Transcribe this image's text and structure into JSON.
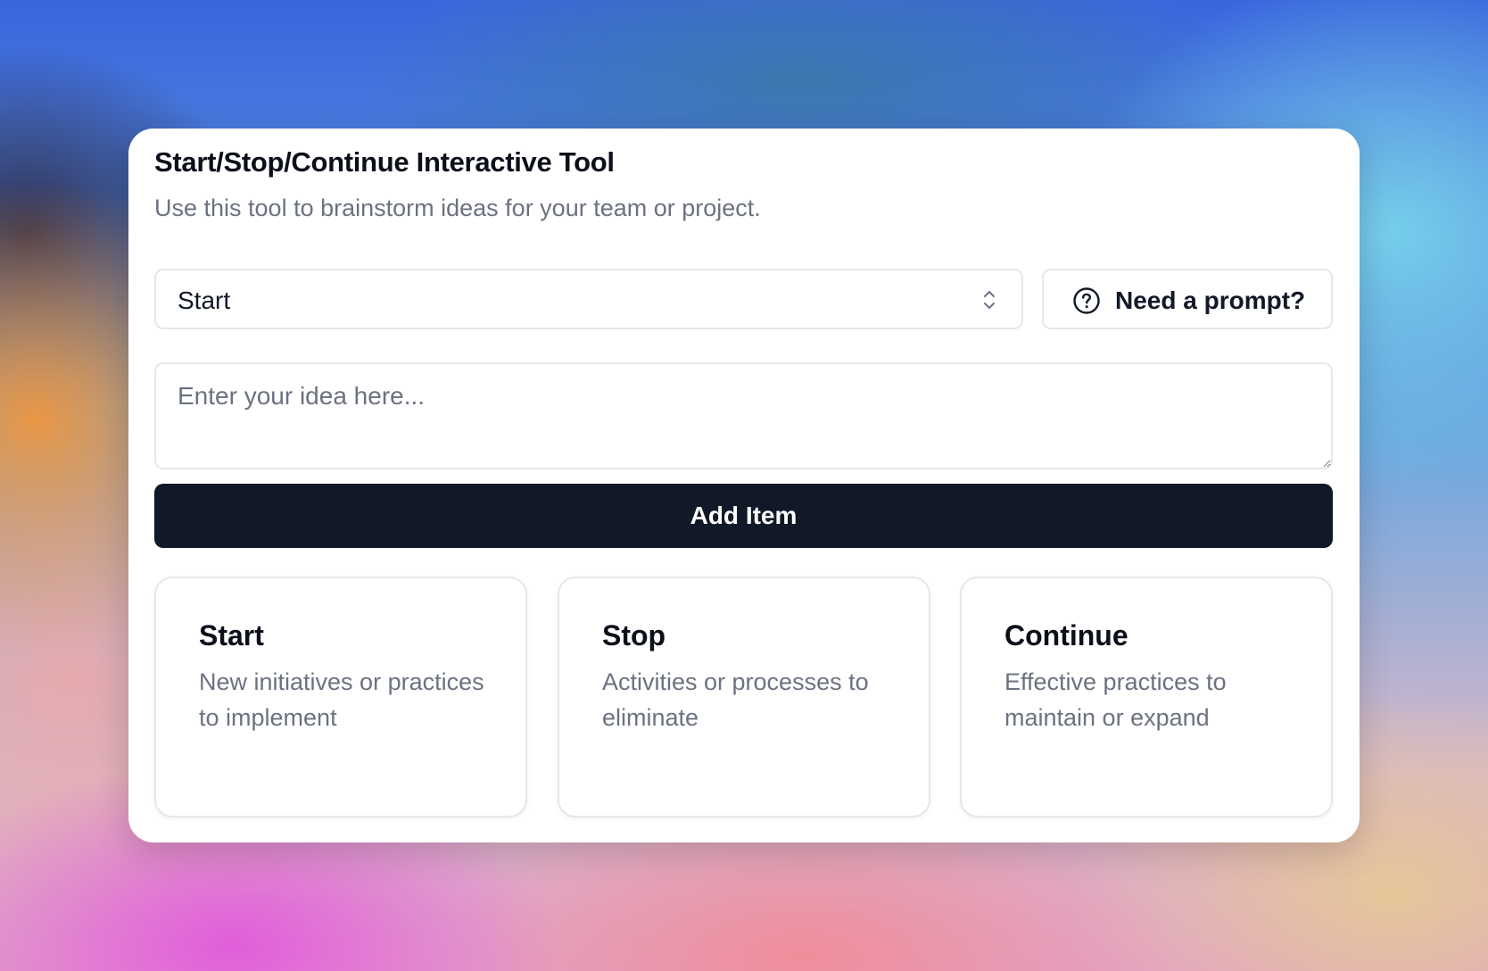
{
  "tool": {
    "title": "Start/Stop/Continue Interactive Tool",
    "subtitle": "Use this tool to brainstorm ideas for your team or project."
  },
  "category_select": {
    "selected": "Start",
    "icon": "chevron-up-down-icon"
  },
  "prompt_button": {
    "label": "Need a prompt?",
    "icon": "question-circle-icon"
  },
  "idea_input": {
    "placeholder": "Enter your idea here...",
    "value": ""
  },
  "add_button": {
    "label": "Add Item"
  },
  "columns": [
    {
      "title": "Start",
      "description": "New initiatives or practices to implement"
    },
    {
      "title": "Stop",
      "description": "Activities or processes to eliminate"
    },
    {
      "title": "Continue",
      "description": "Effective practices to maintain or expand"
    }
  ],
  "colors": {
    "primary_button": "#111827",
    "muted_text": "#6b7280",
    "border": "#e5e7eb"
  }
}
